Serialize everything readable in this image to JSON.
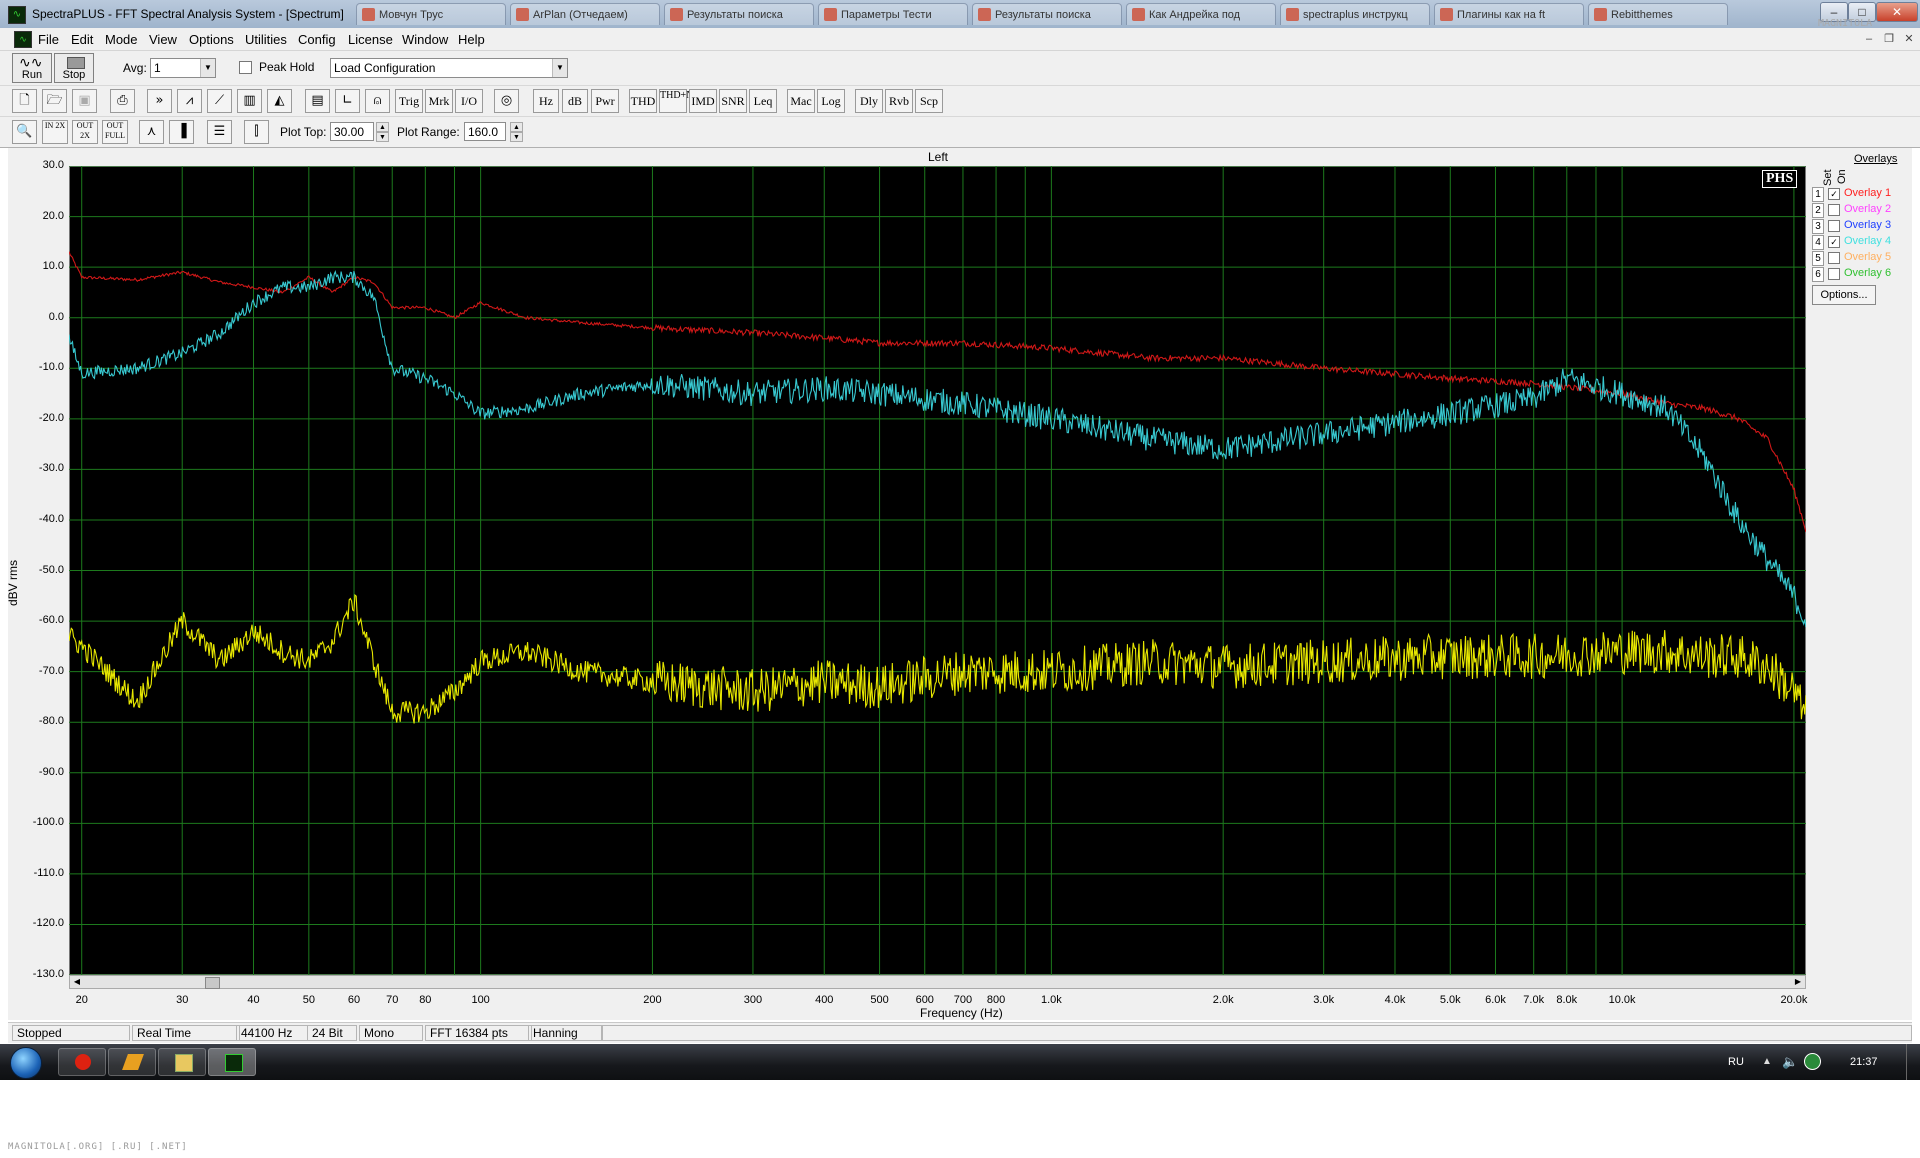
{
  "window": {
    "title": "SpectraPLUS - FFT Spectral Analysis System - [Spectrum]",
    "app_icon": "waveform-icon",
    "browser_tabs": [
      "Мовчун Трус",
      "ArPlan (Отчедаем)",
      "Результаты поиска",
      "Параметры Тести",
      "Результаты поиска",
      "Как Андрейка под",
      "spectraplus инструкц",
      "Плагины как на ft",
      "Rebitthemes"
    ],
    "corner_watermark": "MAGNITOLA"
  },
  "menubar": {
    "items": [
      "File",
      "Edit",
      "Mode",
      "View",
      "Options",
      "Utilities",
      "Config",
      "License",
      "Window",
      "Help"
    ]
  },
  "toolbar": {
    "run_label": "Run",
    "stop_label": "Stop",
    "avg_label": "Avg:",
    "avg_value": "1",
    "peak_hold_label": "Peak Hold",
    "config_value": "Load Configuration",
    "buttons_row2": [
      "Trig",
      "Mrk",
      "I/O",
      "Hz",
      "dB",
      "Pwr",
      "THD",
      "THD+N",
      "IMD",
      "SNR",
      "Leq",
      "Mac",
      "Log",
      "Dly",
      "Rvb",
      "Scp"
    ],
    "plot_top_label": "Plot Top:",
    "plot_top_value": "30.00",
    "plot_range_label": "Plot Range:",
    "plot_range_value": "160.0",
    "zoom_labels": [
      "IN 2X",
      "OUT 2X",
      "OUT FULL"
    ]
  },
  "plot": {
    "title": "Left",
    "phs_badge": "PHS",
    "ylabel": "dBV rms",
    "xlabel": "Frequency (Hz)",
    "y_ticks": [
      "30.0",
      "20.0",
      "10.0",
      "0.0",
      "-10.0",
      "-20.0",
      "-30.0",
      "-40.0",
      "-50.0",
      "-60.0",
      "-70.0",
      "-80.0",
      "-90.0",
      "-100.0",
      "-110.0",
      "-120.0",
      "-130.0"
    ],
    "x_ticks": [
      {
        "label": "20",
        "f": 20
      },
      {
        "label": "30",
        "f": 30
      },
      {
        "label": "40",
        "f": 40
      },
      {
        "label": "50",
        "f": 50
      },
      {
        "label": "60",
        "f": 60
      },
      {
        "label": "70",
        "f": 70
      },
      {
        "label": "80",
        "f": 80
      },
      {
        "label": "100",
        "f": 100
      },
      {
        "label": "200",
        "f": 200
      },
      {
        "label": "300",
        "f": 300
      },
      {
        "label": "400",
        "f": 400
      },
      {
        "label": "500",
        "f": 500
      },
      {
        "label": "600",
        "f": 600
      },
      {
        "label": "700",
        "f": 700
      },
      {
        "label": "800",
        "f": 800
      },
      {
        "label": "1.0k",
        "f": 1000
      },
      {
        "label": "2.0k",
        "f": 2000
      },
      {
        "label": "3.0k",
        "f": 3000
      },
      {
        "label": "4.0k",
        "f": 4000
      },
      {
        "label": "5.0k",
        "f": 5000
      },
      {
        "label": "6.0k",
        "f": 6000
      },
      {
        "label": "7.0k",
        "f": 7000
      },
      {
        "label": "8.0k",
        "f": 8000
      },
      {
        "label": "10.0k",
        "f": 10000
      },
      {
        "label": "20.0k",
        "f": 20000
      }
    ]
  },
  "overlays": {
    "header_label": "Overlays",
    "set_label": "Set",
    "on_label": "On",
    "options_label": "Options...",
    "items": [
      {
        "num": "1",
        "name": "Overlay 1",
        "checked": true,
        "color": "#ff2020"
      },
      {
        "num": "2",
        "name": "Overlay 2",
        "checked": false,
        "color": "#ff40ff"
      },
      {
        "num": "3",
        "name": "Overlay 3",
        "checked": false,
        "color": "#2040ff"
      },
      {
        "num": "4",
        "name": "Overlay 4",
        "checked": true,
        "color": "#40e0e0"
      },
      {
        "num": "5",
        "name": "Overlay 5",
        "checked": false,
        "color": "#ffb060"
      },
      {
        "num": "6",
        "name": "Overlay 6",
        "checked": false,
        "color": "#30c030"
      }
    ]
  },
  "chart_data": {
    "type": "line",
    "title": "Left",
    "xlabel": "Frequency (Hz)",
    "ylabel": "dBV rms",
    "x_scale": "log",
    "xlim": [
      19,
      21000
    ],
    "ylim": [
      -130,
      30
    ],
    "grid": true,
    "series": [
      {
        "name": "Overlay 1",
        "color": "#d01818",
        "x": [
          19,
          20,
          25,
          30,
          35,
          40,
          45,
          50,
          55,
          60,
          65,
          70,
          80,
          90,
          100,
          120,
          150,
          200,
          300,
          400,
          500,
          700,
          1000,
          1500,
          2000,
          3000,
          5000,
          7000,
          10000,
          12000,
          14000,
          16000,
          18000,
          20000,
          21000
        ],
        "y": [
          13,
          8,
          7.5,
          9,
          7,
          6,
          5,
          8,
          5,
          8,
          7,
          2,
          2,
          0,
          3,
          0,
          -1,
          -2,
          -3,
          -4,
          -5,
          -5,
          -6,
          -8,
          -8,
          -10,
          -12,
          -13,
          -15,
          -17,
          -18,
          -20,
          -24,
          -34,
          -42
        ]
      },
      {
        "name": "Overlay 4",
        "color": "#38c8d0",
        "x": [
          19,
          20,
          25,
          30,
          35,
          40,
          45,
          50,
          55,
          60,
          65,
          70,
          80,
          90,
          100,
          120,
          150,
          200,
          300,
          400,
          500,
          700,
          1000,
          1500,
          2000,
          3000,
          5000,
          7000,
          8000,
          10000,
          12000,
          14000,
          16000,
          18000,
          20000,
          21000
        ],
        "y": [
          -4,
          -11,
          -10,
          -7,
          -3,
          3,
          6,
          6,
          8,
          8,
          4,
          -10,
          -12,
          -15,
          -19,
          -18,
          -15,
          -13,
          -15,
          -14,
          -15,
          -17,
          -20,
          -24,
          -26,
          -23,
          -19,
          -16,
          -12,
          -15,
          -18,
          -28,
          -40,
          -48,
          -55,
          -60
        ]
      },
      {
        "name": "",
        "color": "#e8e800",
        "x": [
          19,
          20,
          25,
          30,
          35,
          40,
          45,
          50,
          55,
          60,
          65,
          70,
          80,
          90,
          100,
          120,
          150,
          200,
          300,
          400,
          500,
          700,
          1000,
          1500,
          2000,
          3000,
          5000,
          7000,
          10000,
          12000,
          14000,
          16000,
          18000,
          20000,
          21000
        ],
        "y": [
          -63,
          -65,
          -76,
          -60,
          -68,
          -62,
          -66,
          -68,
          -64,
          -56,
          -68,
          -78,
          -78,
          -74,
          -68,
          -66,
          -70,
          -72,
          -74,
          -72,
          -73,
          -70,
          -70,
          -68,
          -69,
          -68,
          -67,
          -67,
          -66,
          -66,
          -67,
          -67,
          -69,
          -74,
          -79
        ]
      }
    ]
  },
  "statusbar": {
    "cells": [
      "Stopped",
      "Real Time",
      "44100 Hz",
      "24 Bit",
      "Mono",
      "FFT 16384 pts",
      "Hanning"
    ]
  },
  "taskbar": {
    "lang": "RU",
    "clock": "21:37"
  },
  "footer_watermark": "MAGNITOLA[.ORG] [.RU] [.NET]"
}
